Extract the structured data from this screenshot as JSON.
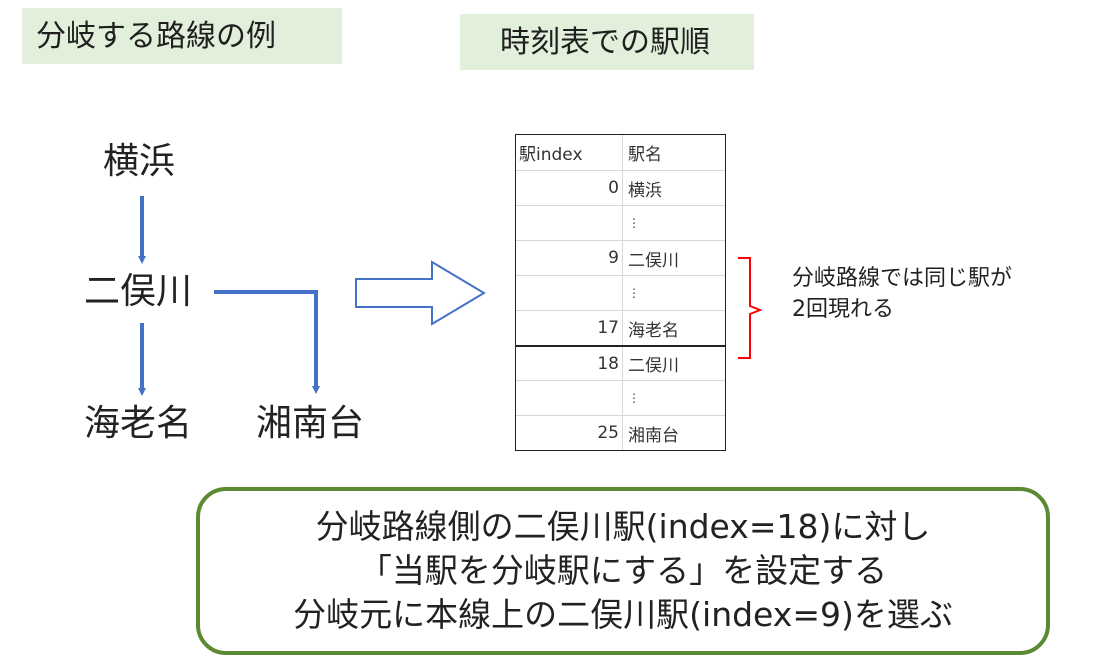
{
  "titles": {
    "left": "分岐する路線の例",
    "right": "時刻表での駅順"
  },
  "diagram": {
    "stations": {
      "yokohama": "横浜",
      "futamatagawa": "二俣川",
      "ebina": "海老名",
      "shonandai": "湘南台"
    },
    "colors": {
      "arrow": "#4472c4",
      "highlight": "#ff0000",
      "title_bg": "#e2efda",
      "box_border": "#5b8a33"
    }
  },
  "timetable": {
    "headers": [
      "駅index",
      "駅名"
    ],
    "rows": [
      {
        "index": "0",
        "name": "横浜"
      },
      {
        "index": "",
        "name": "⋮"
      },
      {
        "index": "9",
        "name": "二俣川"
      },
      {
        "index": "",
        "name": "⋮"
      },
      {
        "index": "17",
        "name": "海老名"
      },
      {
        "index": "18",
        "name": "二俣川"
      },
      {
        "index": "",
        "name": "⋮"
      },
      {
        "index": "25",
        "name": "湘南台"
      }
    ]
  },
  "note": {
    "line1": "分岐路線では同じ駅が",
    "line2": "2回現れる"
  },
  "action": {
    "line1": "分岐路線側の二俣川駅(index=18)に対し",
    "line2": "「当駅を分岐駅にする」を設定する",
    "line3": "分岐元に本線上の二俣川駅(index=9)を選ぶ"
  }
}
